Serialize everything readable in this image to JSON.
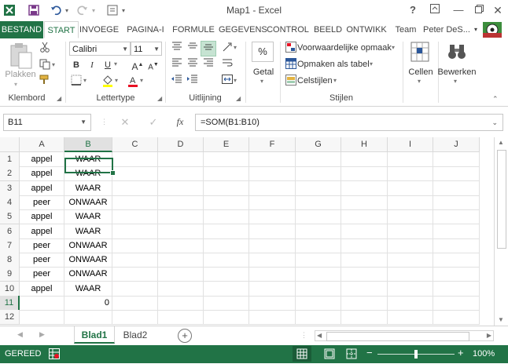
{
  "window": {
    "title": "Map1 - Excel"
  },
  "quick_access": [
    "save-icon",
    "undo-icon",
    "redo-icon",
    "customize-icon"
  ],
  "title_controls": [
    "?",
    "restore",
    "minimize",
    "maximize",
    "close"
  ],
  "tabs": {
    "file": "BESTAND",
    "items": [
      "START",
      "INVOEGE",
      "PAGINA-I",
      "FORMULE",
      "GEGEVENS",
      "CONTROL",
      "BEELD",
      "ONTWIKK",
      "Team"
    ],
    "active": "START",
    "user": "Peter DeS..."
  },
  "ribbon": {
    "clipboard": {
      "paste": "Plakken",
      "label": "Klembord"
    },
    "font": {
      "name": "Calibri",
      "size": "11",
      "bold": "B",
      "italic": "I",
      "underline": "U",
      "label": "Lettertype"
    },
    "alignment": {
      "label": "Uitlijning"
    },
    "number": {
      "percent": "%",
      "label": "Getal"
    },
    "styles": {
      "conditional": "Voorwaardelijke opmaak",
      "table": "Opmaken als tabel",
      "cell": "Celstijlen",
      "label": "Stijlen"
    },
    "cells": {
      "label": "Cellen"
    },
    "editing": {
      "label": "Bewerken"
    }
  },
  "formula_bar": {
    "name_box": "B11",
    "fx": "fx",
    "formula": "=SOM(B1:B10)"
  },
  "grid": {
    "columns": [
      "A",
      "B",
      "C",
      "D",
      "E",
      "F",
      "G",
      "H",
      "I",
      "J"
    ],
    "selected_column": "B",
    "selected_row": "11",
    "rows": [
      {
        "n": "1",
        "a": "appel",
        "b": "WAAR"
      },
      {
        "n": "2",
        "a": "appel",
        "b": "WAAR"
      },
      {
        "n": "3",
        "a": "appel",
        "b": "WAAR"
      },
      {
        "n": "4",
        "a": "peer",
        "b": "ONWAAR"
      },
      {
        "n": "5",
        "a": "appel",
        "b": "WAAR"
      },
      {
        "n": "6",
        "a": "appel",
        "b": "WAAR"
      },
      {
        "n": "7",
        "a": "peer",
        "b": "ONWAAR"
      },
      {
        "n": "8",
        "a": "peer",
        "b": "ONWAAR"
      },
      {
        "n": "9",
        "a": "peer",
        "b": "ONWAAR"
      },
      {
        "n": "10",
        "a": "appel",
        "b": "WAAR"
      },
      {
        "n": "11",
        "a": "",
        "b": "0"
      },
      {
        "n": "12",
        "a": "",
        "b": ""
      }
    ]
  },
  "sheets": {
    "tabs": [
      "Blad1",
      "Blad2"
    ],
    "active": "Blad1",
    "add": "+"
  },
  "status": {
    "ready": "GEREED",
    "zoom": "100%"
  },
  "colors": {
    "accent": "#217346"
  }
}
